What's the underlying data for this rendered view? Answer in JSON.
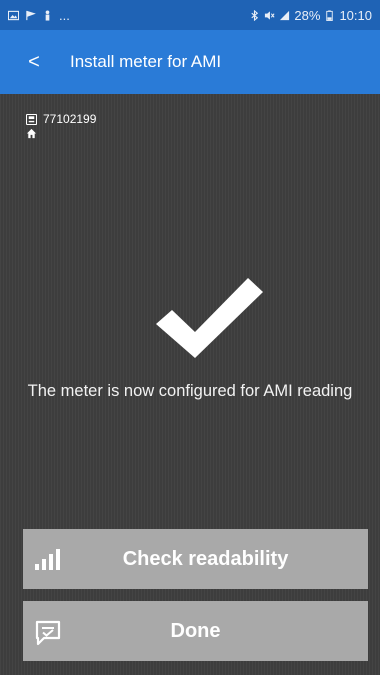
{
  "status_bar": {
    "left_ellipsis": "...",
    "battery_percent": "28%",
    "time": "10:10"
  },
  "header": {
    "back_glyph": "<",
    "title": "Install meter for AMI"
  },
  "meter": {
    "id": "77102199",
    "address": ""
  },
  "message": "The meter is now configured for AMI reading",
  "actions": {
    "check_readability_label": "Check readability",
    "done_label": "Done"
  },
  "icons": {
    "status_left": [
      "image-icon",
      "flag-icon",
      "person-icon"
    ],
    "status_right": [
      "bluetooth-icon",
      "mute-icon",
      "signal-icon",
      "battery-icon"
    ],
    "meter_id": "meter-icon",
    "address": "home-icon",
    "success": "checkmark-icon",
    "check_readability": "signal-bars-icon",
    "done": "check-form-icon"
  },
  "colors": {
    "status_bar": "#1f63b5",
    "app_bar": "#2a7bd7",
    "background": "#3d3d3d",
    "button": "#a9a9a9"
  }
}
